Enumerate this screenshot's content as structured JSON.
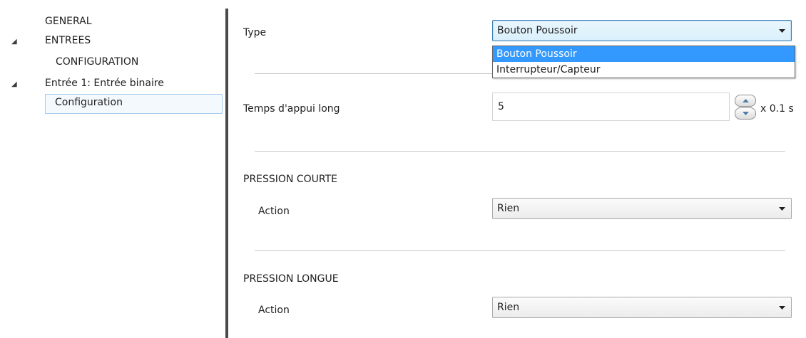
{
  "sidebar": {
    "items": [
      {
        "label": "GENERAL",
        "expanded": false
      },
      {
        "label": "ENTREES",
        "expanded": true
      },
      {
        "label": "CONFIGURATION",
        "expanded": false
      },
      {
        "label": "Entrée 1: Entrée binaire",
        "expanded": true
      },
      {
        "label": "Configuration",
        "selected": true
      }
    ],
    "arrow_glyph": "◢"
  },
  "form": {
    "type": {
      "label": "Type",
      "value": "Bouton Poussoir",
      "options": [
        "Bouton Poussoir",
        "Interrupteur/Capteur"
      ]
    },
    "long_press_time": {
      "label": "Temps d'appui long",
      "value": "5",
      "unit": "x 0.1 s"
    },
    "short_press": {
      "title": "PRESSION COURTE",
      "action_label": "Action",
      "action_value": "Rien"
    },
    "long_press": {
      "title": "PRESSION LONGUE",
      "action_label": "Action",
      "action_value": "Rien"
    }
  },
  "colors": {
    "selection_blue": "#3399ff",
    "splitter": "#4a4a4a",
    "selected_item_border": "#a8cdee"
  }
}
